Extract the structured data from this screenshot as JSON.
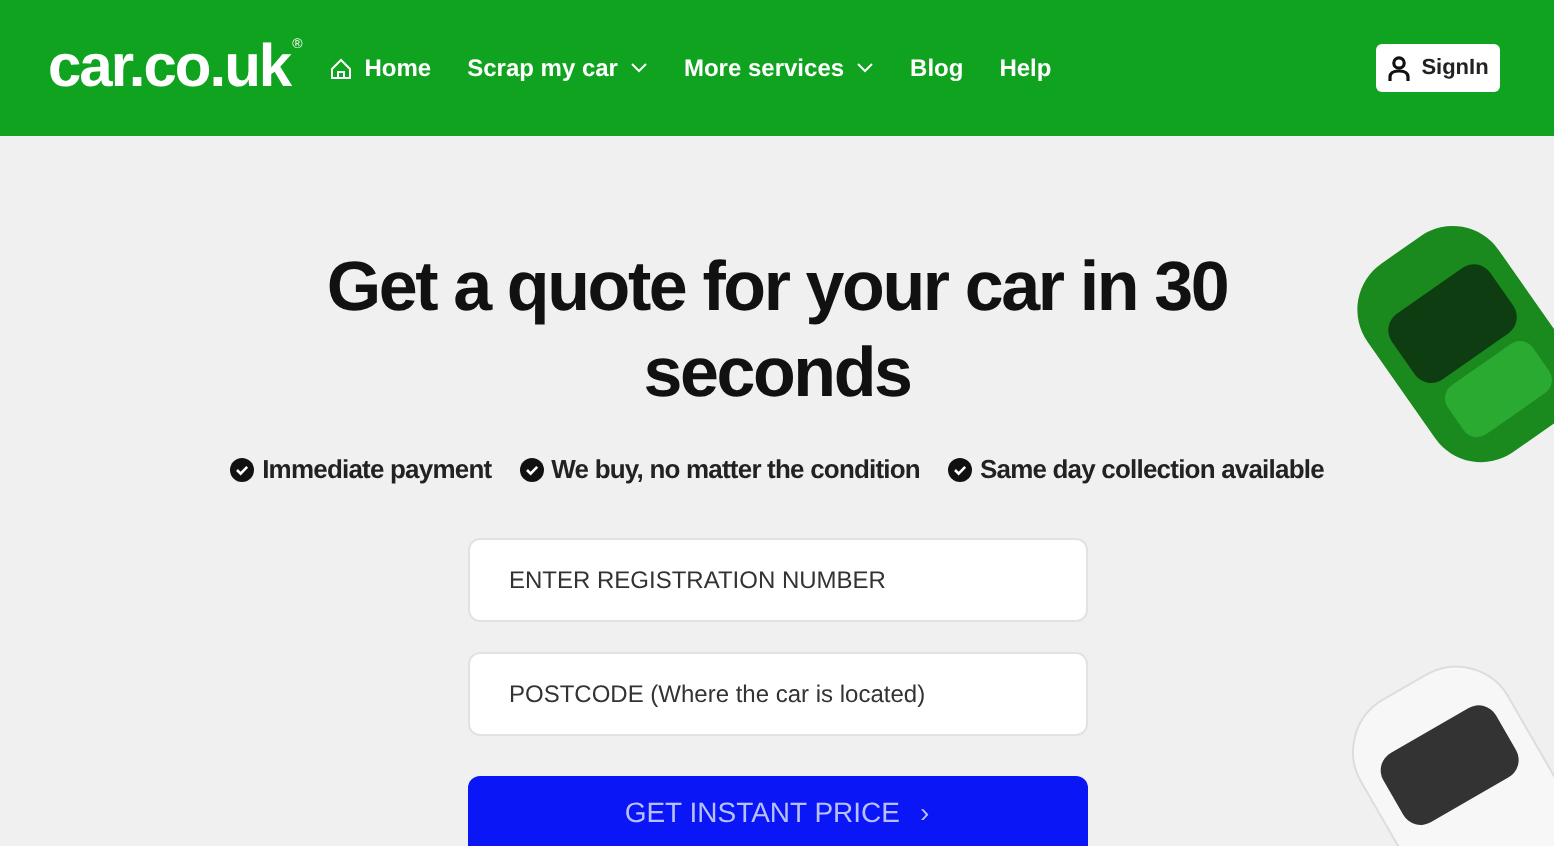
{
  "header": {
    "logo": "car.co.uk",
    "logo_mark": "®",
    "nav": [
      {
        "label": "Home",
        "kind": "home"
      },
      {
        "label": "Scrap my car",
        "kind": "dropdown"
      },
      {
        "label": "More services",
        "kind": "dropdown"
      },
      {
        "label": "Blog",
        "kind": "link"
      },
      {
        "label": "Help",
        "kind": "link"
      }
    ],
    "sign_in": "SignIn"
  },
  "hero": {
    "title": "Get a quote for your car in 30 seconds",
    "benefits": [
      "Immediate payment",
      "We buy, no matter the condition",
      "Same day collection available"
    ],
    "fields": [
      {
        "placeholder": "ENTER REGISTRATION NUMBER"
      },
      {
        "placeholder": "POSTCODE (Where the car is located)"
      }
    ],
    "button": "GET INSTANT PRICE",
    "button_icon": "›"
  }
}
